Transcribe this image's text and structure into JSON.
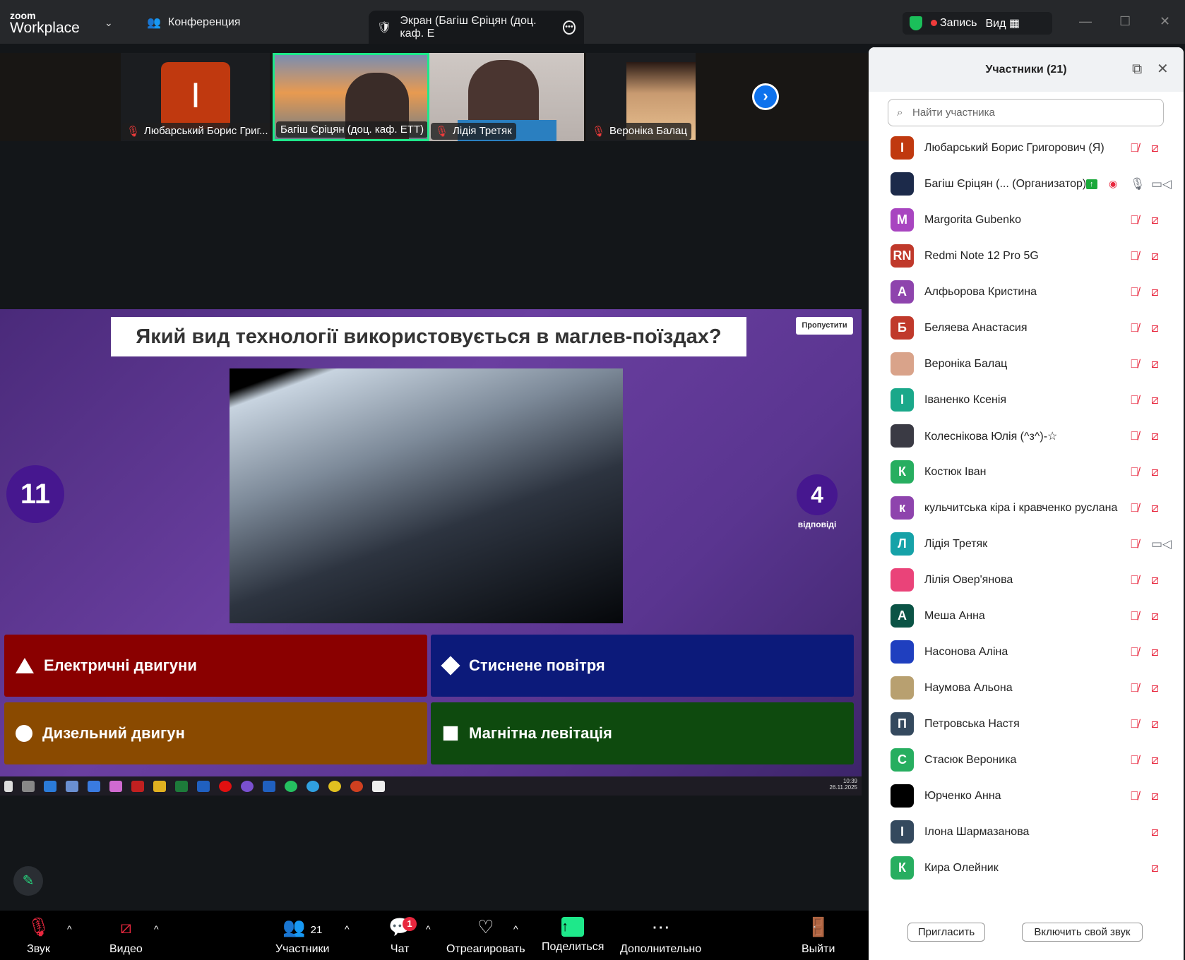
{
  "app": {
    "logo_top": "zoom",
    "logo_bottom": "Workplace",
    "meeting_tab": "Конференция",
    "screen_tab": "Экран (Багіш Єріцян (доц. каф. Е",
    "record_label": "Запись",
    "view_label": "Вид"
  },
  "video_tiles": [
    {
      "name": "Любарський Борис Григ...",
      "initial": "I",
      "color": "#c0390f"
    },
    {
      "name": "Багіш Єріцян (доц. каф. ЕТТ)",
      "active": true
    },
    {
      "name": "Лідія Третяк"
    },
    {
      "name": "Вероніка Балац"
    }
  ],
  "quiz": {
    "question": "Який вид технології використовується в маглев-поїздах?",
    "skip": "Пропустити",
    "timer": "11",
    "answers_count": "4",
    "answers_label": "відповіді",
    "answers": [
      {
        "text": "Електричні двигуни",
        "color": "#8a0000",
        "shape": "triangle"
      },
      {
        "text": "Стиснене повітря",
        "color": "#0c1a7a",
        "shape": "diamond"
      },
      {
        "text": "Дизельний двигун",
        "color": "#8a4a00",
        "shape": "circle"
      },
      {
        "text": "Магнітна левітація",
        "color": "#0e4a0e",
        "shape": "square"
      }
    ],
    "clock_time": "10:39",
    "clock_date": "26.11.2025"
  },
  "toolbar": {
    "audio": "Звук",
    "video": "Видео",
    "participants": "Участники",
    "participants_count": "21",
    "chat": "Чат",
    "chat_badge": "1",
    "react": "Отреагировать",
    "share": "Поделиться",
    "more": "Дополнительно",
    "leave": "Выйти"
  },
  "panel": {
    "title": "Участники (21)",
    "search_placeholder": "Найти участника",
    "invite": "Пригласить",
    "unmute": "Включить свой звук",
    "participants": [
      {
        "initial": "I",
        "color": "#c0390f",
        "name": "Любарський Борис Григорович (Я)",
        "mic": "off",
        "cam": "off"
      },
      {
        "initial": "",
        "color": "#1c2a4a",
        "name": "Багіш Єріцян (...  (Организатор)",
        "mic": "on",
        "cam": "on",
        "sharing": true,
        "recording": true
      },
      {
        "initial": "M",
        "color": "#a845c0",
        "name": "Margorita Gubenko",
        "mic": "off",
        "cam": "off"
      },
      {
        "initial": "RN",
        "color": "#c0392b",
        "name": "Redmi Note 12 Pro 5G",
        "mic": "off",
        "cam": "off"
      },
      {
        "initial": "А",
        "color": "#8e44ad",
        "name": "Алфьорова Кристина",
        "mic": "off",
        "cam": "off"
      },
      {
        "initial": "Б",
        "color": "#c0392b",
        "name": "Беляева Анастасия",
        "mic": "off",
        "cam": "off"
      },
      {
        "initial": "",
        "color": "#d9a38a",
        "name": "Вероніка Балац",
        "mic": "off",
        "cam": "off"
      },
      {
        "initial": "І",
        "color": "#1aa88a",
        "name": "Іваненко Ксенія",
        "mic": "off",
        "cam": "off"
      },
      {
        "initial": "",
        "color": "#3a3a44",
        "name": "Колеснікова Юлія (^з^)-☆",
        "mic": "off",
        "cam": "off"
      },
      {
        "initial": "К",
        "color": "#27ae60",
        "name": "Костюк Іван",
        "mic": "off",
        "cam": "off"
      },
      {
        "initial": "к",
        "color": "#8e44ad",
        "name": "кульчитська кіра і кравченко руслана",
        "mic": "off",
        "cam": "off"
      },
      {
        "initial": "Л",
        "color": "#16a2a8",
        "name": "Лідія Третяк",
        "mic": "off",
        "cam": "on"
      },
      {
        "initial": "",
        "color": "#ea4379",
        "name": "Лілія Овер'янова",
        "mic": "off",
        "cam": "off"
      },
      {
        "initial": "A",
        "color": "#0b5345",
        "name": "Меша Анна",
        "mic": "off",
        "cam": "off"
      },
      {
        "initial": "",
        "color": "#1f3fbf",
        "name": "Насонова Аліна",
        "mic": "off",
        "cam": "off"
      },
      {
        "initial": "",
        "color": "#b8a070",
        "name": "Наумова Альона",
        "mic": "off",
        "cam": "off"
      },
      {
        "initial": "П",
        "color": "#34495e",
        "name": "Петровська Настя",
        "mic": "off",
        "cam": "off"
      },
      {
        "initial": "С",
        "color": "#27ae60",
        "name": "Стасюк Вероника",
        "mic": "off",
        "cam": "off"
      },
      {
        "initial": "",
        "color": "#000000",
        "name": "Юрченко Анна",
        "mic": "off",
        "cam": "off"
      },
      {
        "initial": "I",
        "color": "#34495e",
        "name": "Ілона Шармазанова",
        "mic": "none",
        "cam": "off"
      },
      {
        "initial": "К",
        "color": "#27ae60",
        "name": "Кира Олейник",
        "mic": "none",
        "cam": "off"
      }
    ]
  }
}
